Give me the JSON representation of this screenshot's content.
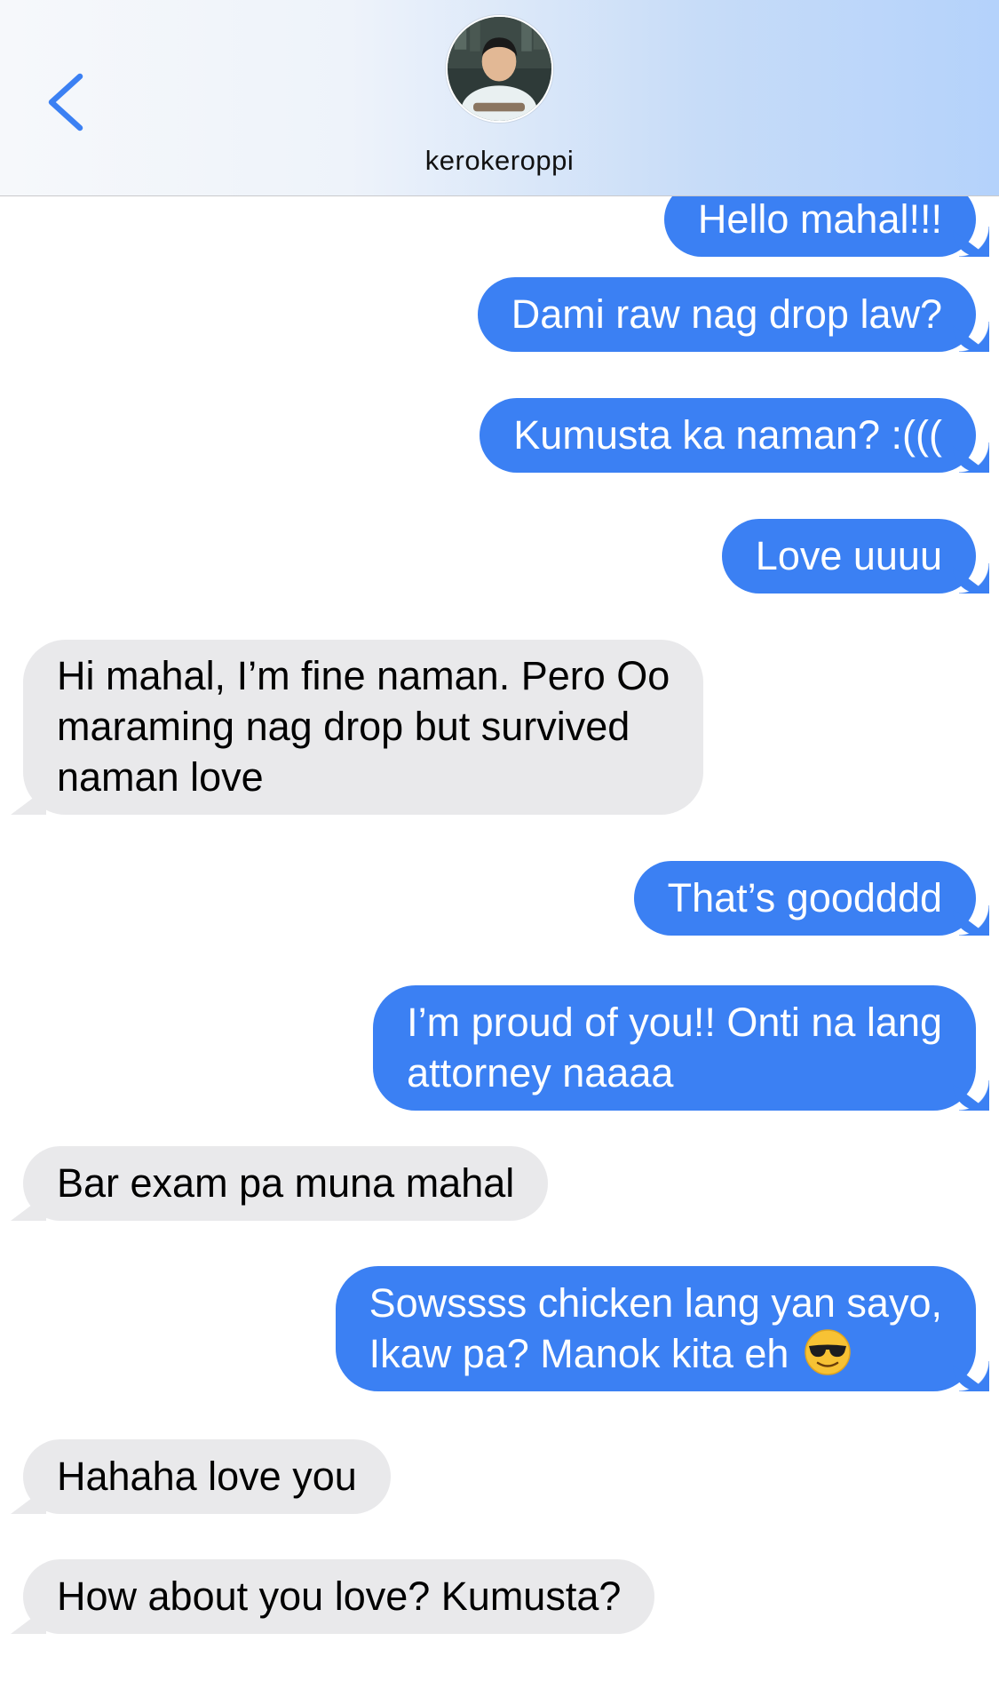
{
  "header": {
    "contact_name": "kerokeroppi",
    "back_icon": "chevron-left-icon",
    "avatar_icon": "contact-avatar"
  },
  "colors": {
    "sent_bubble": "#3b80f3",
    "received_bubble": "#e9e9eb",
    "accent": "#3b80f3"
  },
  "messages": [
    {
      "direction": "sent",
      "lines": [
        "Hello mahal!!!"
      ]
    },
    {
      "direction": "sent",
      "lines": [
        "Dami raw nag drop law?"
      ]
    },
    {
      "direction": "sent",
      "lines": [
        "Kumusta ka naman? :((("
      ]
    },
    {
      "direction": "sent",
      "lines": [
        "Love uuuu"
      ]
    },
    {
      "direction": "received",
      "lines": [
        "Hi mahal, I’m fine naman. Pero Oo",
        "maraming nag drop but survived",
        "naman love"
      ]
    },
    {
      "direction": "sent",
      "lines": [
        "That’s goodddd"
      ]
    },
    {
      "direction": "sent",
      "lines": [
        "I’m proud of you!! Onti na lang",
        "attorney naaaa"
      ]
    },
    {
      "direction": "received",
      "lines": [
        "Bar exam pa muna mahal"
      ]
    },
    {
      "direction": "sent",
      "lines": [
        "Sowssss chicken lang yan sayo,",
        "Ikaw pa? Manok kita eh"
      ],
      "emoji": "sunglasses-emoji"
    },
    {
      "direction": "received",
      "lines": [
        "Hahaha love you"
      ]
    },
    {
      "direction": "received",
      "lines": [
        "How about you love? Kumusta?"
      ]
    }
  ]
}
